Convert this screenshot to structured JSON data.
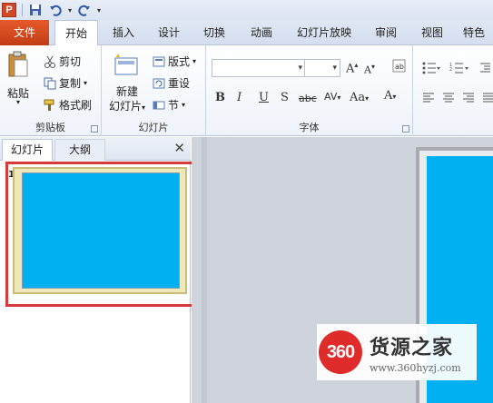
{
  "app": {
    "icon_letter": "P"
  },
  "tabs": [
    "文件",
    "开始",
    "插入",
    "设计",
    "切换",
    "动画",
    "幻灯片放映",
    "审阅",
    "视图",
    "特色"
  ],
  "ribbon": {
    "clipboard": {
      "paste": "粘贴",
      "cut": "剪切",
      "copy": "复制",
      "format_painter": "格式刷",
      "label": "剪贴板"
    },
    "slides": {
      "new_line1": "新建",
      "new_line2": "幻灯片",
      "layout": "版式",
      "reset": "重设",
      "section": "节",
      "label": "幻灯片"
    },
    "font": {
      "label": "字体",
      "bold": "B",
      "italic": "I",
      "underline": "U",
      "shadow": "S",
      "strike": "abc",
      "spacing": "AV",
      "case": "Aa",
      "color": "A",
      "grow": "A",
      "shrink": "A"
    }
  },
  "pane": {
    "tab_slides": "幻灯片",
    "tab_outline": "大纲",
    "close": "✕",
    "slide_number": "1"
  },
  "colors": {
    "slide_fill": "#00b0f0",
    "file_tab": "#d24726",
    "highlight": "#d63b3b"
  },
  "watermark": {
    "logo": "360",
    "name": "货源之家",
    "url": "www.360hyzj.com"
  }
}
